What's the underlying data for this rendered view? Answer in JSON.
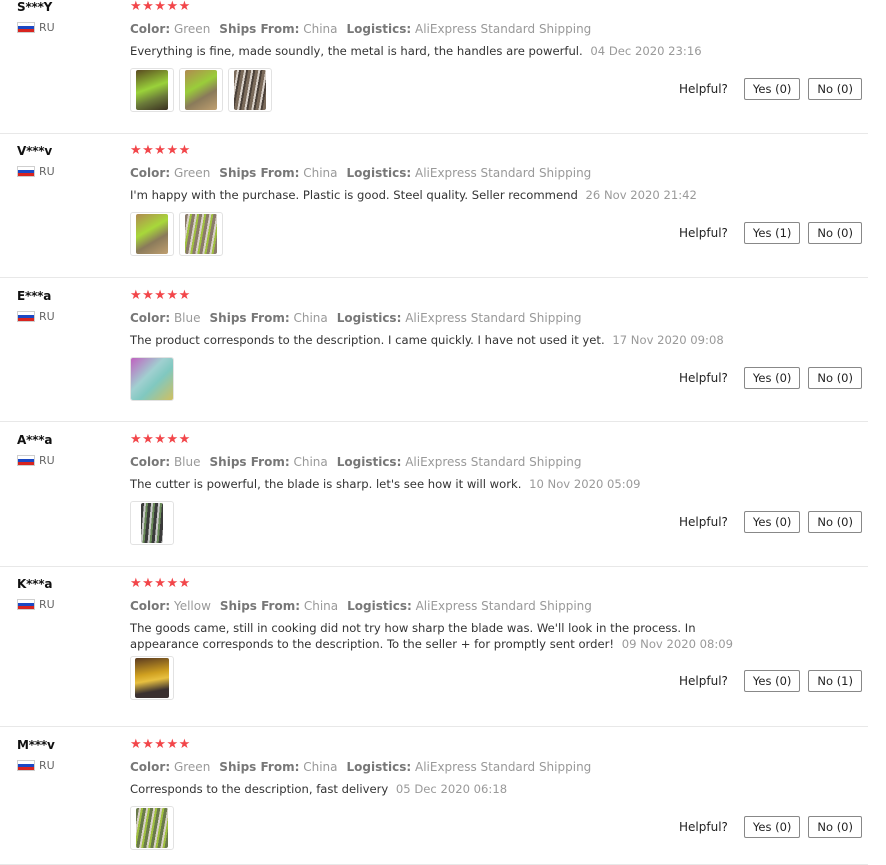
{
  "helpful_label": "Helpful?",
  "labels": {
    "color": "Color:",
    "ships": "Ships From:",
    "logistics": "Logistics:"
  },
  "colors": {
    "star": "#f2464a",
    "flag_white": "#ffffff",
    "flag_blue": "#1b48c4",
    "flag_red": "#d8241f"
  },
  "reviews": [
    {
      "user": "S***Y",
      "country": "RU",
      "stars": "★★★★★",
      "color": "Green",
      "ships_from": "China",
      "logistics": "AliExpress Standard Shipping",
      "text": "Everything is fine, made soundly, the metal is hard, the handles are powerful.",
      "date": "04 Dec 2020 23:16",
      "photos": [
        "photo-green-cutter",
        "photo-green-handle",
        "photo-blade-comb"
      ],
      "yes": "Yes (0)",
      "no": "No (0)"
    },
    {
      "user": "V***v",
      "country": "RU",
      "stars": "★★★★★",
      "color": "Green",
      "ships_from": "China",
      "logistics": "AliExpress Standard Shipping",
      "text": "I'm happy with the purchase. Plastic is good. Steel quality. Seller recommend",
      "date": "26 Nov 2020 21:42",
      "photos": [
        "photo-green-handle",
        "photo-blade-comb"
      ],
      "yes": "Yes (1)",
      "no": "No (0)"
    },
    {
      "user": "E***a",
      "country": "RU",
      "stars": "★★★★★",
      "color": "Blue",
      "ships_from": "China",
      "logistics": "AliExpress Standard Shipping",
      "text": "The product corresponds to the description. I came quickly. I have not used it yet.",
      "date": "17 Nov 2020 09:08",
      "photos": [
        "photo-blue-cutter"
      ],
      "yes": "Yes (0)",
      "no": "No (0)"
    },
    {
      "user": "A***a",
      "country": "RU",
      "stars": "★★★★★",
      "color": "Blue",
      "ships_from": "China",
      "logistics": "AliExpress Standard Shipping",
      "text": "The cutter is powerful, the blade is sharp. let's see how it will work.",
      "date": "10 Nov 2020 05:09",
      "photos": [
        "photo-blade-dark"
      ],
      "yes": "Yes (0)",
      "no": "No (0)"
    },
    {
      "user": "K***a",
      "country": "RU",
      "stars": "★★★★★",
      "color": "Yellow",
      "ships_from": "China",
      "logistics": "AliExpress Standard Shipping",
      "text": "The goods came, still in cooking did not try how sharp the blade was. We'll look in the process. In appearance corresponds to the description. To the seller + for promptly sent order!",
      "date": "09 Nov 2020 08:09",
      "photos": [
        "photo-yellow-cutter"
      ],
      "yes": "Yes (0)",
      "no": "No (1)"
    },
    {
      "user": "M***v",
      "country": "RU",
      "stars": "★★★★★",
      "color": "Green",
      "ships_from": "China",
      "logistics": "AliExpress Standard Shipping",
      "text": "Corresponds to the description, fast delivery",
      "date": "05 Dec 2020 06:18",
      "photos": [
        "photo-blade-comb"
      ],
      "yes": "Yes (0)",
      "no": "No (0)"
    }
  ]
}
